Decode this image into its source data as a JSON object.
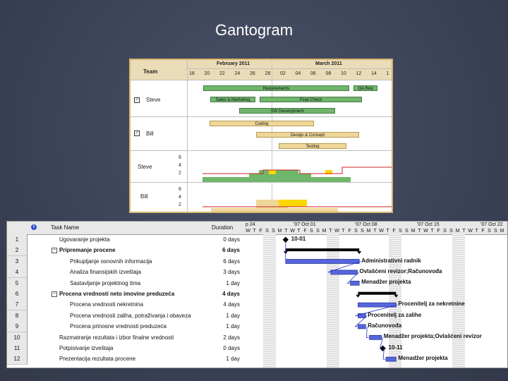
{
  "slide": {
    "title": "Gantogram"
  },
  "team_chart": {
    "header": {
      "team_label": "Team",
      "month1": "February 2011",
      "month2": "March 2011",
      "days": [
        "18",
        "20",
        "22",
        "24",
        "26",
        "28",
        "02",
        "04",
        "06",
        "08",
        "10",
        "12",
        "14",
        "1"
      ]
    },
    "resources": [
      {
        "name": "Steve",
        "checked": true
      },
      {
        "name": "Bill",
        "checked": true
      }
    ],
    "bars": [
      {
        "label": "Requirements",
        "style": "green"
      },
      {
        "label": "QA Req",
        "style": "green"
      },
      {
        "label": "Sales & Marketing",
        "style": "green"
      },
      {
        "label": "Final Check",
        "style": "green"
      },
      {
        "label": "SW Development",
        "style": "green"
      },
      {
        "label": "Coding",
        "style": "tan"
      },
      {
        "label": "Design & Concept",
        "style": "tan"
      },
      {
        "label": "Testing",
        "style": "tan"
      }
    ],
    "load": [
      {
        "name": "Steve",
        "ticks": [
          "6",
          "4",
          "2"
        ]
      },
      {
        "name": "Bill",
        "ticks": [
          "6",
          "4",
          "2"
        ]
      }
    ],
    "colors": {
      "header": "#eadcb8",
      "border": "#d7b36b",
      "green": "#6fb56a",
      "tan": "#efd79a",
      "over": "#ffd700",
      "limit": "#cc2222"
    }
  },
  "project": {
    "columns": {
      "info_icon": "i",
      "task_name": "Task Name",
      "duration": "Duration"
    },
    "timescale": {
      "weeks": [
        "p 24",
        "'07 Oct 01",
        "'07 Oct 08",
        "'07 Oct 15",
        "'07 Oct 22"
      ],
      "days": [
        "W",
        "T",
        "F",
        "S",
        "S",
        "M",
        "T",
        "W",
        "T",
        "F",
        "S",
        "S",
        "M",
        "T",
        "W",
        "T",
        "F",
        "S",
        "S",
        "M",
        "T",
        "W",
        "T",
        "F",
        "S",
        "S",
        "M",
        "T",
        "W",
        "T",
        "F",
        "S",
        "S",
        "M",
        "T",
        "W",
        "T",
        "F",
        "S",
        "S",
        "M"
      ]
    },
    "tasks": [
      {
        "id": "1",
        "name": "Ugovaranje projekta",
        "duration": "0 days",
        "level": 0,
        "summary": false,
        "label": "10-01"
      },
      {
        "id": "2",
        "name": "Pripremanje procene",
        "duration": "6 days",
        "level": 0,
        "summary": true,
        "label": ""
      },
      {
        "id": "3",
        "name": "Prikupljanje osnovnih informacija",
        "duration": "6 days",
        "level": 1,
        "summary": false,
        "label": "Administrativni radnik"
      },
      {
        "id": "4",
        "name": "Analiza finansijskih izveštaja",
        "duration": "3 days",
        "level": 1,
        "summary": false,
        "label": "Ovlašćeni revizor;Računovođa"
      },
      {
        "id": "5",
        "name": "Sastavljanje projektnog tima",
        "duration": "1 day",
        "level": 1,
        "summary": false,
        "label": "Menadžer projekta"
      },
      {
        "id": "6",
        "name": "Procena vrednosti neto imovine preduzeća",
        "duration": "4 days",
        "level": 0,
        "summary": true,
        "label": ""
      },
      {
        "id": "7",
        "name": "Procena vrednosti nekretnina",
        "duration": "4 days",
        "level": 1,
        "summary": false,
        "label": "Procenitelj za nekretnine"
      },
      {
        "id": "8",
        "name": "Procena vrednosti zaliha, potraživanja i obaveza",
        "duration": "1 day",
        "level": 1,
        "summary": false,
        "label": "Procenitelj za zalihe"
      },
      {
        "id": "9",
        "name": "Procena prinosne vrednosti preduzeća",
        "duration": "1 day",
        "level": 1,
        "summary": false,
        "label": "Računovođa"
      },
      {
        "id": "10",
        "name": "Razmatranje rezultata i izbor finalne vrednosti",
        "duration": "2 days",
        "level": 0,
        "summary": false,
        "label": "Menadžer projekta;Ovlašćeni revizor"
      },
      {
        "id": "11",
        "name": "Potpisivanje izveštaja",
        "duration": "0 days",
        "level": 0,
        "summary": false,
        "label": "10-11"
      },
      {
        "id": "12",
        "name": "Prezentacija rezultata procene",
        "duration": "1 day",
        "level": 0,
        "summary": false,
        "label": "Menadžer projekta"
      }
    ],
    "colors": {
      "bar": "#4a5ad0",
      "summary": "#000000",
      "link": "#2233cc"
    }
  }
}
